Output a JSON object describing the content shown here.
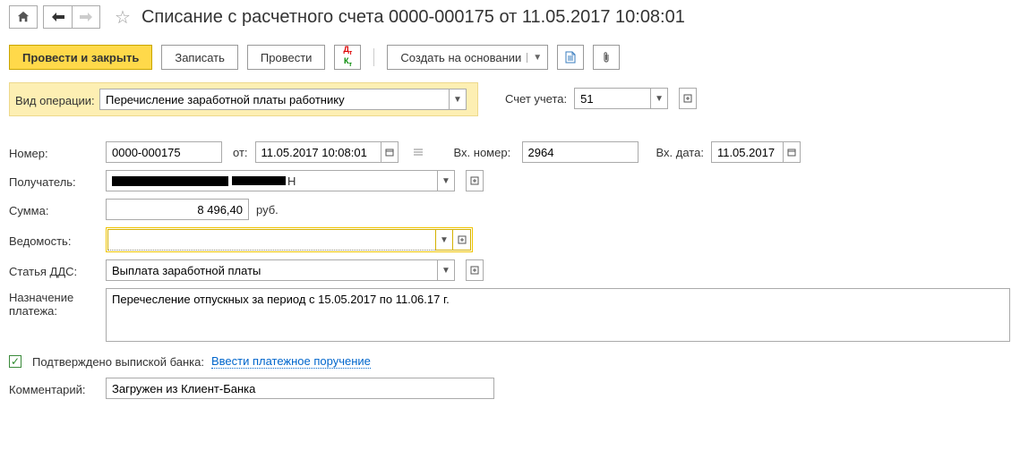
{
  "header": {
    "title": "Списание с расчетного счета 0000-000175 от 11.05.2017 10:08:01"
  },
  "toolbar": {
    "post_close": "Провести и закрыть",
    "save": "Записать",
    "post": "Провести",
    "create_based": "Создать на основании"
  },
  "labels": {
    "op_type": "Вид операции:",
    "account": "Счет учета:",
    "number": "Номер:",
    "from": "от:",
    "in_number": "Вх. номер:",
    "in_date": "Вх. дата:",
    "recipient": "Получатель:",
    "sum": "Сумма:",
    "sum_suffix": "руб.",
    "vedomost": "Ведомость:",
    "dds": "Статья ДДС:",
    "purpose": "Назначение платежа:",
    "confirmed": "Подтверждено выпиской банка:",
    "enter_order": "Ввести платежное поручение",
    "comment": "Комментарий:"
  },
  "fields": {
    "op_type": "Перечисление заработной платы работнику",
    "account": "51",
    "number": "0000-000175",
    "date": "11.05.2017 10:08:01",
    "in_number": "2964",
    "in_date": "11.05.2017",
    "recipient": "",
    "sum": "8 496,40",
    "vedomost": "",
    "dds": "Выплата заработной платы",
    "purpose": "Перечесление отпускных за период с 15.05.2017 по 11.06.17 г.",
    "comment": "Загружен из Клиент-Банка"
  }
}
